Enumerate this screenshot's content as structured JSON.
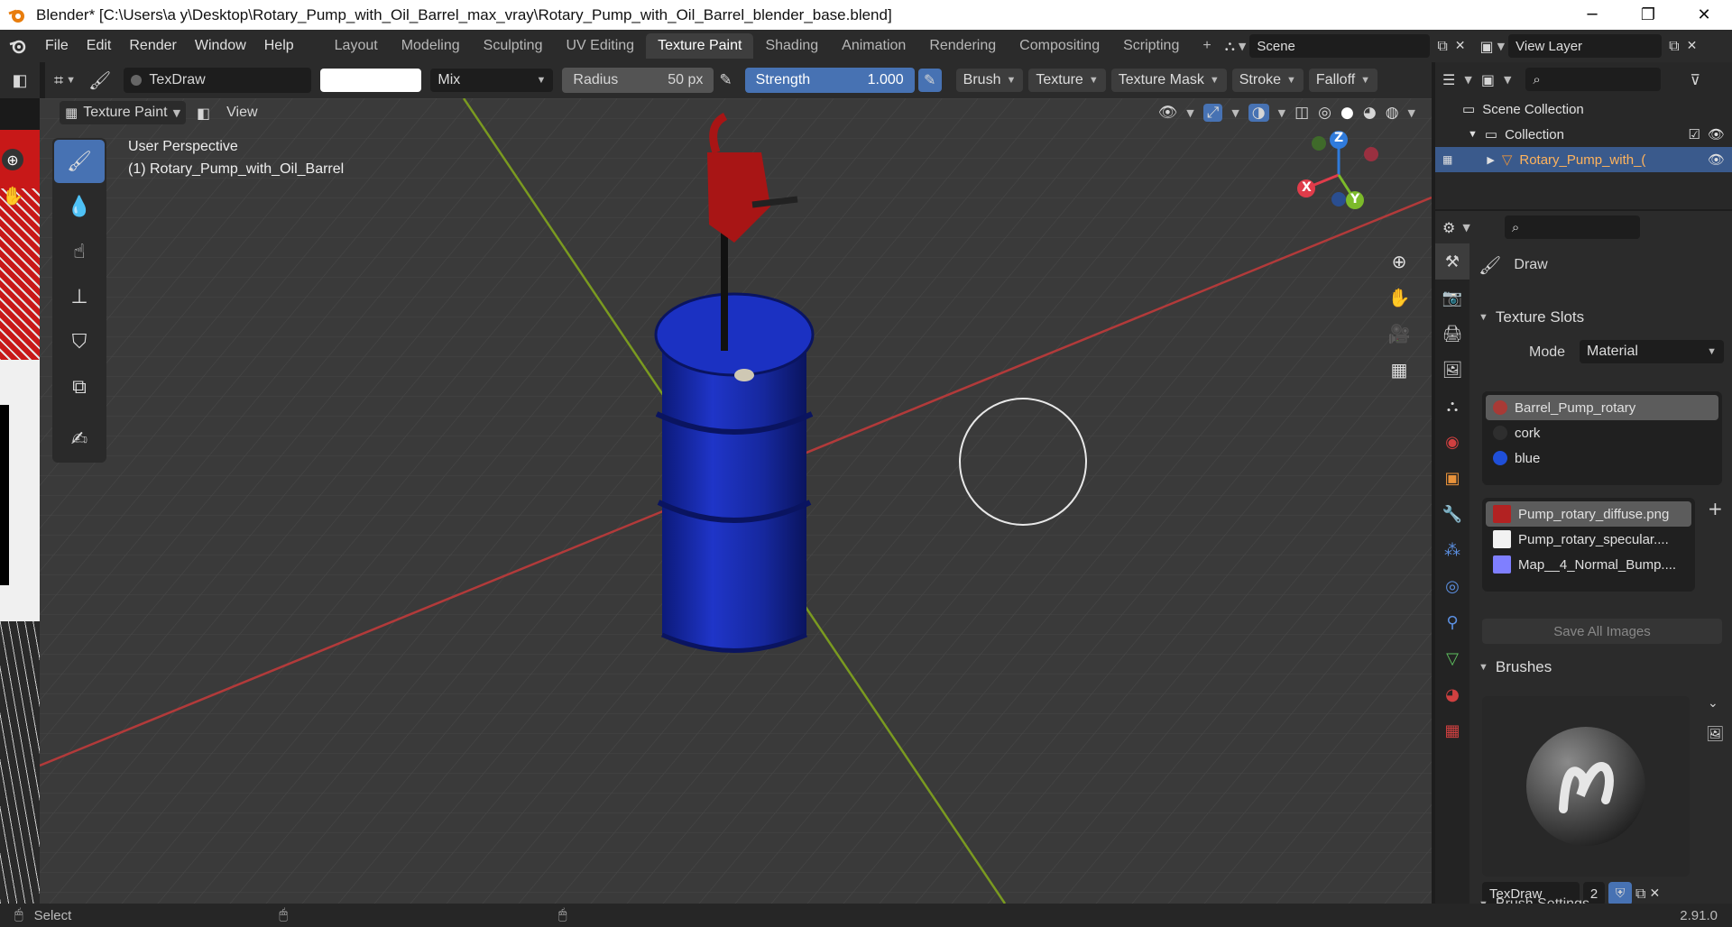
{
  "window": {
    "title": "Blender* [C:\\Users\\a y\\Desktop\\Rotary_Pump_with_Oil_Barrel_max_vray\\Rotary_Pump_with_Oil_Barrel_blender_base.blend]",
    "minimize": "─",
    "maximize": "❐",
    "close": "✕"
  },
  "menubar": {
    "menus": [
      "File",
      "Edit",
      "Render",
      "Window",
      "Help"
    ],
    "workspaces": [
      "Layout",
      "Modeling",
      "Sculpting",
      "UV Editing",
      "Texture Paint",
      "Shading",
      "Animation",
      "Rendering",
      "Compositing",
      "Scripting"
    ],
    "active_workspace": "Texture Paint",
    "add_tab": "+",
    "scene": "Scene",
    "view_layer": "View Layer"
  },
  "tool_header": {
    "brush_name": "TexDraw",
    "blend_mode": "Mix",
    "radius_label": "Radius",
    "radius_value": "50 px",
    "strength_label": "Strength",
    "strength_value": "1.000",
    "strength_fraction": 1.0,
    "menus": [
      "Brush",
      "Texture",
      "Texture Mask",
      "Stroke",
      "Falloff"
    ],
    "color": "#ffffff"
  },
  "viewport_header": {
    "mode": "Texture Paint",
    "view_menu": "View"
  },
  "viewport": {
    "perspective": "User Perspective",
    "object_info": "(1) Rotary_Pump_with_Oil_Barrel",
    "gizmo": {
      "x": "X",
      "y": "Y",
      "z": "Z"
    },
    "barrel_color": "#1a2fb0"
  },
  "outliner": {
    "scene_collection": "Scene Collection",
    "collection": "Collection",
    "object": "Rotary_Pump_with_("
  },
  "properties": {
    "active_tool": "Draw",
    "texture_slots": {
      "header": "Texture Slots",
      "mode_label": "Mode",
      "mode_value": "Material",
      "materials": [
        {
          "name": "Barrel_Pump_rotary",
          "color": "#a83a36"
        },
        {
          "name": "cork",
          "color": "#2e2e2e"
        },
        {
          "name": "blue",
          "color": "#1f4fd8"
        }
      ],
      "images": [
        {
          "name": "Pump_rotary_diffuse.png",
          "color": "#b22222"
        },
        {
          "name": "Pump_rotary_specular....",
          "color": "#f2f2f2"
        },
        {
          "name": "Map__4_Normal_Bump....",
          "color": "#7f7fff"
        }
      ],
      "save_all": "Save All Images"
    },
    "brushes": {
      "header": "Brushes",
      "name": "TexDraw",
      "users": "2"
    },
    "brush_settings": "Brush Settings"
  },
  "statusbar": {
    "select": "Select",
    "version": "2.91.0"
  }
}
